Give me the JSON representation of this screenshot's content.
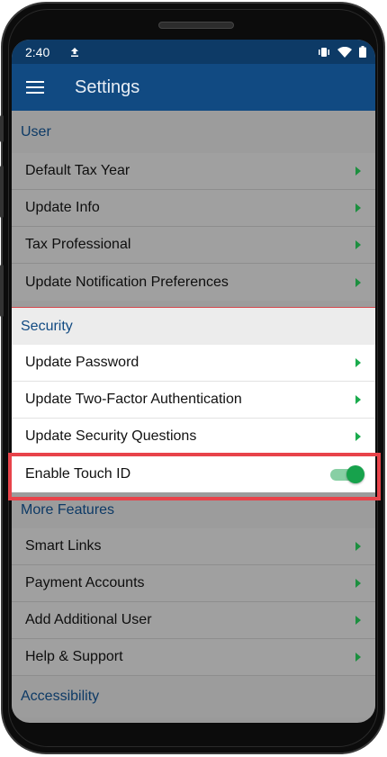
{
  "status_bar": {
    "time": "2:40",
    "icons": [
      "upload-icon",
      "vibrate-icon",
      "wifi-icon",
      "battery-icon"
    ]
  },
  "app_bar": {
    "title": "Settings",
    "menu_icon": "menu-icon"
  },
  "sections": {
    "user": {
      "header": "User",
      "items": [
        "Default Tax Year",
        "Update Info",
        "Tax Professional",
        "Update Notification Preferences"
      ]
    },
    "security": {
      "header": "Security",
      "items": [
        "Update Password",
        "Update Two-Factor Authentication",
        "Update Security Questions"
      ],
      "touch_id": {
        "label": "Enable Touch ID",
        "enabled": true
      }
    },
    "more_features": {
      "header": "More Features",
      "items": [
        "Smart Links",
        "Payment Accounts",
        "Add Additional User",
        "Help & Support"
      ]
    },
    "accessibility": {
      "header": "Accessibility"
    }
  },
  "colors": {
    "app_bar": "#114a82",
    "status_bar": "#0d3a66",
    "chevron": "#1aab4d",
    "toggle_on": "#17a24c",
    "highlight": "#e8434a"
  }
}
